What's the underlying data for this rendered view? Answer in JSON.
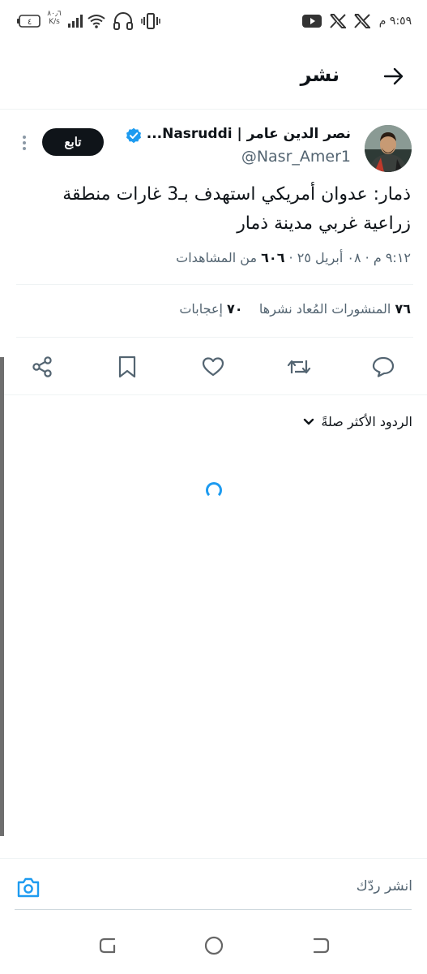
{
  "status_bar": {
    "time": "٩:٥٩ م",
    "net_speed_value": "٨٠٫٦",
    "net_speed_unit": "K/s",
    "battery": "٤"
  },
  "header": {
    "title": "نشر"
  },
  "tweet": {
    "display_name": "نصر الدين عامر | Nasruddi...",
    "handle": "@Nasr_Amer1",
    "follow_label": "تابع",
    "text_line1": "ذمار: عدوان أمريكي استهدف بـ3 غارات منطقة",
    "text_line2": "زراعية غربي مدينة ذمار",
    "time": "٩:١٢ م",
    "date": "٠٨ أبريل ٢٥",
    "views_count": "٦٠٦",
    "views_label": "من المشاهدات",
    "reposts_count": "٧٦",
    "reposts_label": "المنشورات المُعاد نشرها",
    "likes_count": "٧٠",
    "likes_label": "إعجابات"
  },
  "replies": {
    "sort_label": "الردود الأكثر صلةً"
  },
  "composer": {
    "placeholder": "انشر ردّك"
  },
  "colors": {
    "accent": "#1d9bf0",
    "text_primary": "#0f1419",
    "text_secondary": "#536471"
  },
  "icons": [
    "youtube-icon",
    "x-icon",
    "battery-icon",
    "wifi-icon",
    "headphones-icon",
    "vibrate-icon",
    "back-arrow-icon",
    "verified-badge-icon",
    "more-icon",
    "reply-icon",
    "repost-icon",
    "like-icon",
    "bookmark-icon",
    "share-icon",
    "chevron-down-icon",
    "camera-icon"
  ]
}
